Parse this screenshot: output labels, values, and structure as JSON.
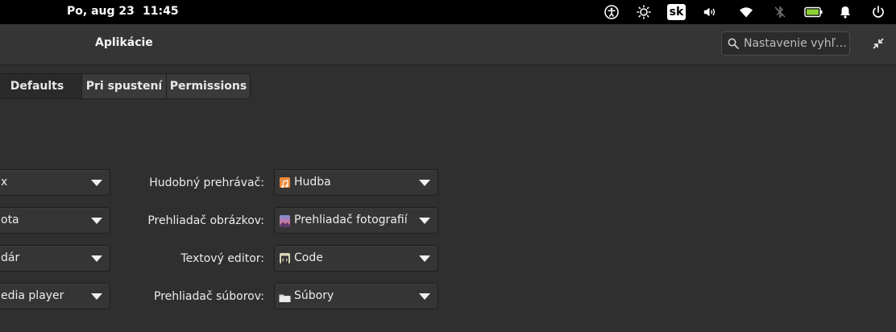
{
  "panel": {
    "date": "Po, aug 23",
    "time": "11:45",
    "keyboard_layout": "sk",
    "indicators": [
      "accessibility-icon",
      "night-light-icon",
      "keyboard-layout",
      "volume-icon",
      "wifi-icon",
      "bluetooth-off-icon",
      "battery-icon",
      "notifications-icon",
      "power-icon"
    ]
  },
  "header": {
    "title": "Aplikácie",
    "search_placeholder": "Nastavenie vyhľ…"
  },
  "tabs": [
    {
      "label": "Defaults",
      "active": true
    },
    {
      "label": "Pri spustení",
      "active": false
    },
    {
      "label": "Permissions",
      "active": false
    }
  ],
  "left_column": [
    {
      "value": "x"
    },
    {
      "value": "ota"
    },
    {
      "value": "dár"
    },
    {
      "value": "edia player"
    }
  ],
  "right_column": [
    {
      "label": "Hudobný prehrávač:",
      "value": "Hudba",
      "icon": "music-app-icon"
    },
    {
      "label": "Prehliadač obrázkov:",
      "value": "Prehliadač fotografií",
      "icon": "photos-app-icon"
    },
    {
      "label": "Textový editor:",
      "value": "Code",
      "icon": "code-app-icon"
    },
    {
      "label": "Prehliadač súborov:",
      "value": "Súbory",
      "icon": "folder-app-icon"
    }
  ],
  "colors": {
    "background": "#2f2f2f",
    "panel": "#000000",
    "header": "#353535",
    "dropdown": "#353535"
  }
}
